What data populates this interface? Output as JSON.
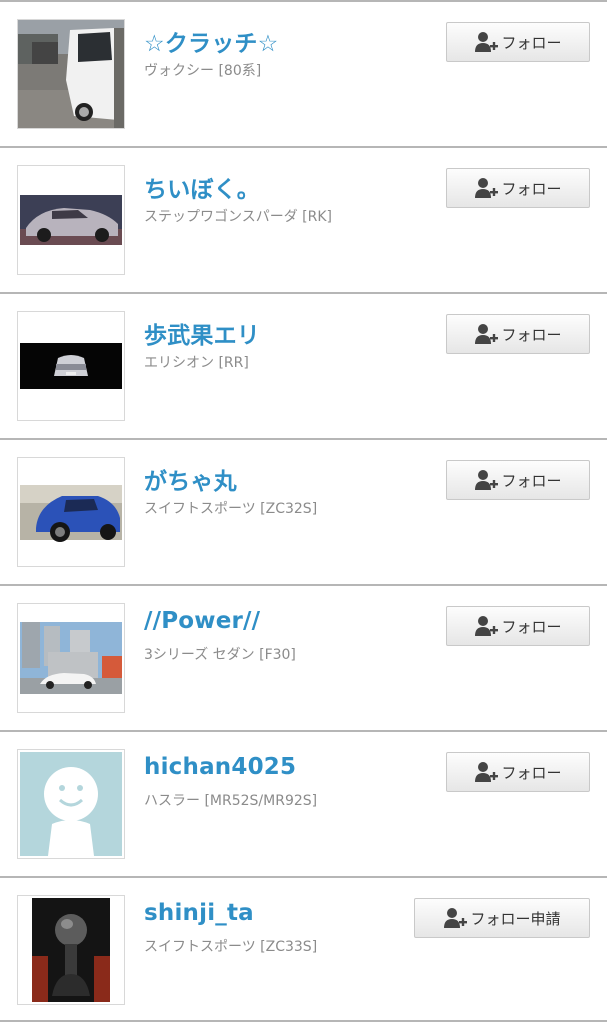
{
  "users": [
    {
      "name": "☆クラッチ☆",
      "car": "ヴォクシー [80系]",
      "button": "フォロー",
      "photo": "parked-white-minivan-photo"
    },
    {
      "name": "ちいぼく。",
      "car": "ステップワゴンスパーダ [RK]",
      "button": "フォロー",
      "photo": "silver-sports-car-photo"
    },
    {
      "name": "歩武果エリ",
      "car": "エリシオン [RR]",
      "button": "フォロー",
      "photo": "minivan-night-photo"
    },
    {
      "name": "がちゃ丸",
      "car": "スイフトスポーツ [ZC32S]",
      "button": "フォロー",
      "photo": "blue-hatchback-photo"
    },
    {
      "name": "//Power//",
      "car": "3シリーズ セダン [F30]",
      "button": "フォロー",
      "photo": "white-sedan-building-photo"
    },
    {
      "name": "hichan4025",
      "car": "ハスラー [MR52S/MR92S]",
      "button": "フォロー",
      "photo": "default-avatar-photo"
    },
    {
      "name": "shinji_ta",
      "car": "スイフトスポーツ [ZC33S]",
      "button": "フォロー申請",
      "photo": "shift-knob-photo"
    }
  ],
  "icons": {
    "follow": "add-user-icon"
  },
  "colors": {
    "name": "#2f8fc6",
    "subtext": "#8b8b8b",
    "divider": "#b6b6b6"
  }
}
